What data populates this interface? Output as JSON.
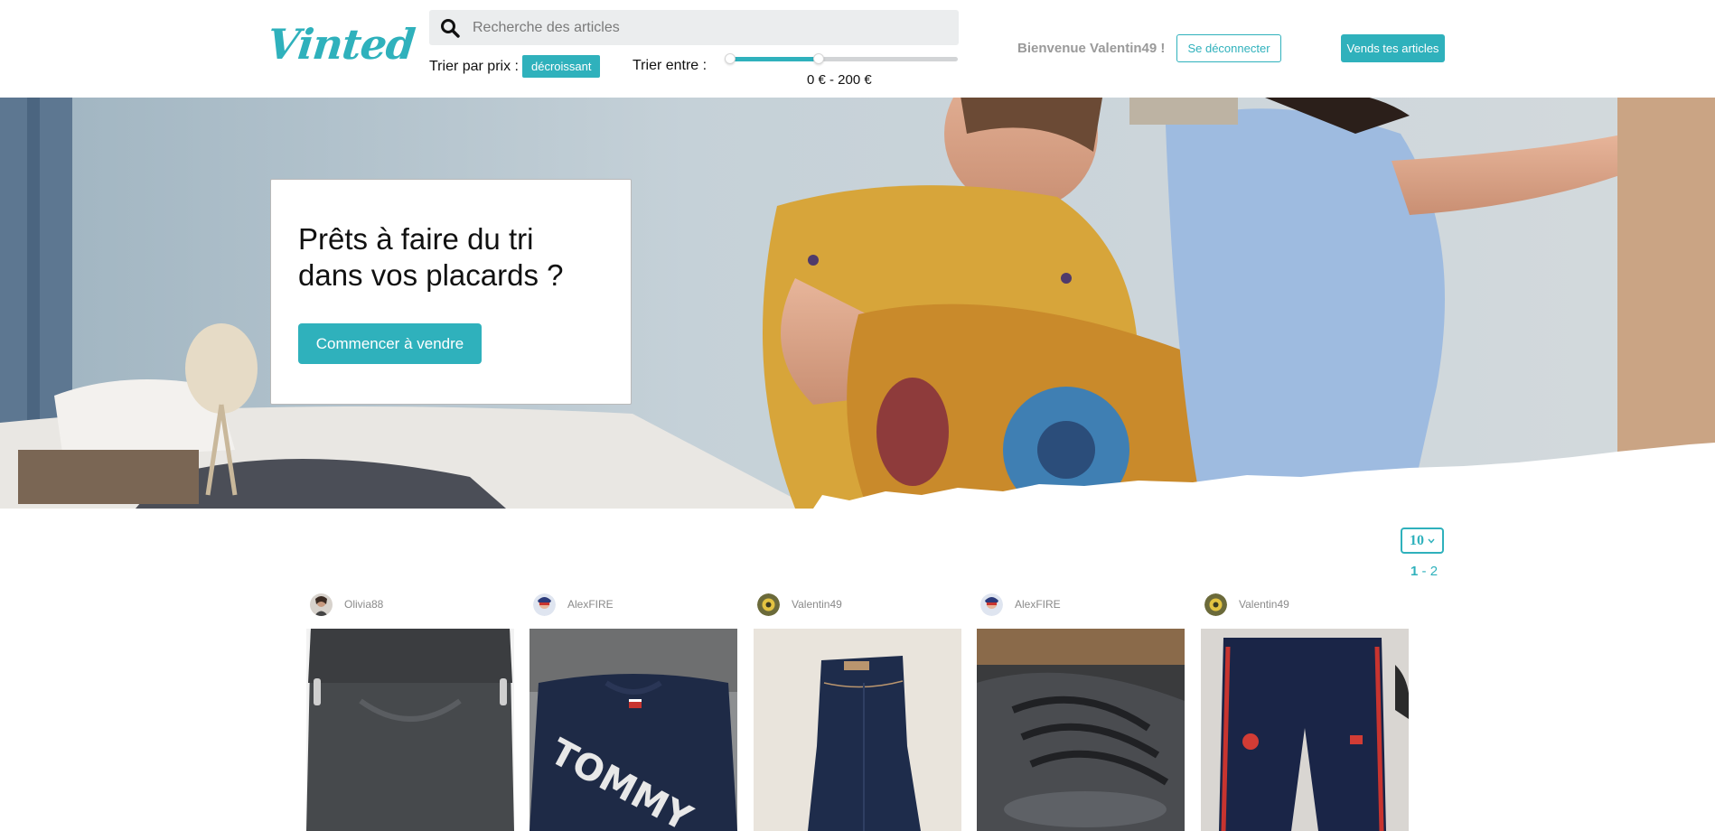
{
  "header": {
    "logo": "Vinted",
    "search_placeholder": "Recherche des articles",
    "sort_price_label": "Trier par prix :",
    "sort_price_value": "décroissant",
    "range_label": "Trier entre :",
    "range_value": "0 € - 200 €",
    "range_fraction_low": 0,
    "range_fraction_high": 0.4,
    "welcome": "Bienvenue Valentin49 !",
    "logout_label": "Se déconnecter",
    "sell_label": "Vends tes articles"
  },
  "hero": {
    "title": "Prêts à faire du tri dans vos placards ?",
    "cta_label": "Commencer à vendre"
  },
  "listing": {
    "per_page": "10",
    "pages": [
      "1",
      "2"
    ],
    "current_page": "1",
    "items": [
      {
        "user": "Olivia88",
        "image_icon": "skirt-photo"
      },
      {
        "user": "AlexFIRE",
        "image_icon": "tshirt-photo"
      },
      {
        "user": "Valentin49",
        "image_icon": "jeans-photo"
      },
      {
        "user": "AlexFIRE",
        "image_icon": "sneakers-photo"
      },
      {
        "user": "Valentin49",
        "image_icon": "pants-photo"
      }
    ]
  },
  "colors": {
    "accent": "#2fb1bc"
  }
}
